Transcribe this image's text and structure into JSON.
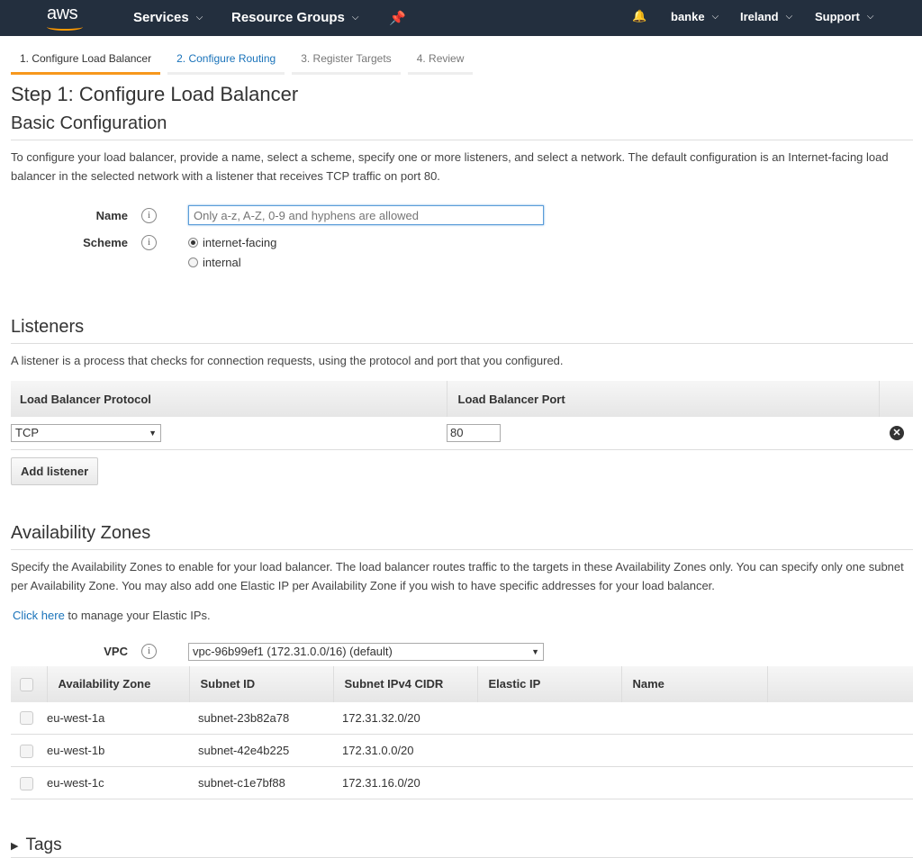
{
  "nav": {
    "logo": "aws",
    "services": "Services",
    "resource_groups": "Resource Groups",
    "user": "banke",
    "region": "Ireland",
    "support": "Support",
    "accent": "#ff9900"
  },
  "steps": [
    "1. Configure Load Balancer",
    "2. Configure Routing",
    "3. Register Targets",
    "4. Review"
  ],
  "title": "Step 1: Configure Load Balancer",
  "basic": {
    "heading": "Basic Configuration",
    "desc": "To configure your load balancer, provide a name, select a scheme, specify one or more listeners, and select a network. The default configuration is an Internet-facing load balancer in the selected network with a listener that receives TCP traffic on port 80.",
    "name_label": "Name",
    "name_placeholder": "Only a-z, A-Z, 0-9 and hyphens are allowed",
    "name_value": "",
    "scheme_label": "Scheme",
    "scheme_options": [
      "internet-facing",
      "internal"
    ],
    "scheme_selected": "internet-facing"
  },
  "listeners": {
    "heading": "Listeners",
    "desc": "A listener is a process that checks for connection requests, using the protocol and port that you configured.",
    "col_protocol": "Load Balancer Protocol",
    "col_port": "Load Balancer Port",
    "protocol": "TCP",
    "port": "80",
    "add_label": "Add listener"
  },
  "az": {
    "heading": "Availability Zones",
    "desc": "Specify the Availability Zones to enable for your load balancer. The load balancer routes traffic to the targets in these Availability Zones only. You can specify only one subnet per Availability Zone. You may also add one Elastic IP per Availability Zone if you wish to have specific addresses for your load balancer.",
    "link": "Click here",
    "link_suffix": " to manage your Elastic IPs.",
    "vpc_label": "VPC",
    "vpc_value": "vpc-96b99ef1 (172.31.0.0/16) (default)",
    "columns": [
      "Availability Zone",
      "Subnet ID",
      "Subnet IPv4 CIDR",
      "Elastic IP",
      "Name"
    ],
    "rows": [
      [
        "eu-west-1a",
        "subnet-23b82a78",
        "172.31.32.0/20"
      ],
      [
        "eu-west-1b",
        "subnet-42e4b225",
        "172.31.0.0/20"
      ],
      [
        "eu-west-1c",
        "subnet-c1e7bf88",
        "172.31.16.0/20"
      ]
    ]
  },
  "tags": {
    "heading": "Tags"
  }
}
